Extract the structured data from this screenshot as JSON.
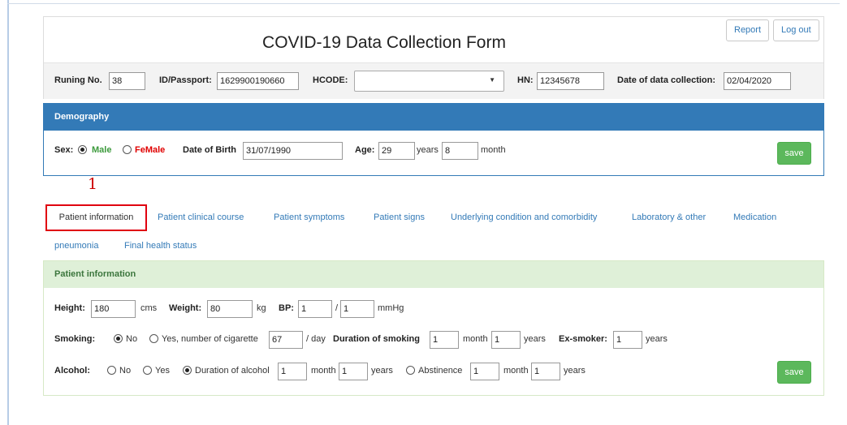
{
  "header": {
    "title": "COVID-19 Data Collection Form",
    "report_label": "Report",
    "logout_label": "Log out"
  },
  "meta": {
    "running_no_label": "Runing No.",
    "running_no_value": "38",
    "id_label": "ID/Passport:",
    "id_value": "1629900190660",
    "hcode_label": "HCODE:",
    "hcode_value": "",
    "hn_label": "HN:",
    "hn_value": "12345678",
    "date_label": "Date of data collection:",
    "date_value": "02/04/2020"
  },
  "demography": {
    "title": "Demography",
    "sex_label": "Sex:",
    "male_label": "Male",
    "female_label": "FeMale",
    "selected_sex": "Male",
    "dob_label": "Date of Birth",
    "dob_value": "31/07/1990",
    "age_label": "Age:",
    "age_years_value": "29",
    "years_unit": "years",
    "age_months_value": "8",
    "month_unit": "month",
    "save_label": "save"
  },
  "annotation": {
    "number": "1"
  },
  "tabs": {
    "active": "Patient information",
    "items": [
      "Patient clinical course",
      "Patient symptoms",
      "Patient signs",
      "Underlying condition and comorbidity",
      "Laboratory & other",
      "Medication",
      "pneumonia",
      "Final health status"
    ]
  },
  "patient_info": {
    "title": "Patient information",
    "height_label": "Height:",
    "height_value": "180",
    "height_unit": "cms",
    "weight_label": "Weight:",
    "weight_value": "80",
    "weight_unit": "kg",
    "bp_label": "BP:",
    "bp_sys_value": "1",
    "bp_sep": "/",
    "bp_dia_value": "1",
    "bp_unit": "mmHg",
    "smoking_label": "Smoking:",
    "smoking_no_label": "No",
    "smoking_yes_label": "Yes, number of cigarette",
    "cigarette_value": "67",
    "per_day_label": "/ day",
    "duration_smoking_label": "Duration of smoking",
    "smoking_month_value": "1",
    "month_unit": "month",
    "smoking_year_value": "1",
    "years_unit": "years",
    "ex_smoker_label": "Ex-smoker:",
    "ex_smoker_value": "1",
    "alcohol_label": "Alcohol:",
    "alcohol_no_label": "No",
    "alcohol_yes_label": "Yes",
    "alcohol_duration_label": "Duration of alcohol",
    "alcohol_month_value": "1",
    "alcohol_year_value": "1",
    "abstinence_label": "Abstinence",
    "abstinence_month_value": "1",
    "abstinence_year_value": "1",
    "save_label": "save"
  }
}
